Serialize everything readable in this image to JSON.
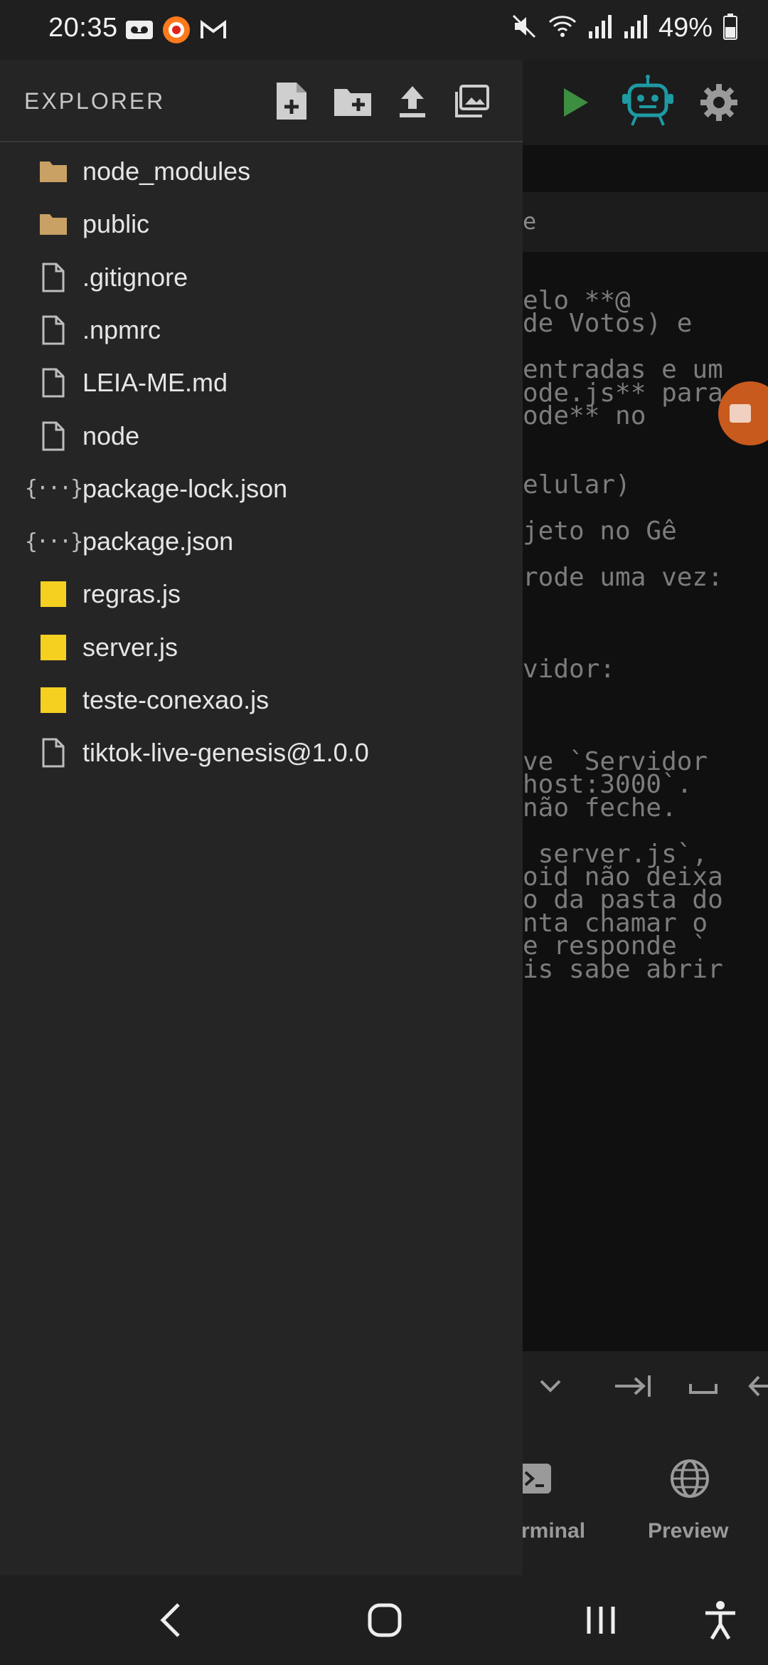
{
  "status_bar": {
    "time": "20:35",
    "battery_percent": "49%",
    "left_icons": [
      "voicemail-icon",
      "recorder-icon",
      "gmail-icon"
    ],
    "right_icons": [
      "mute-icon",
      "wifi-icon",
      "signal-icon",
      "signal-icon",
      "battery-icon"
    ]
  },
  "drawer": {
    "title": "EXPLORER",
    "header_actions": [
      "new-file-icon",
      "new-folder-icon",
      "upload-icon",
      "image-icon"
    ],
    "files": [
      {
        "name": "node_modules",
        "type": "folder"
      },
      {
        "name": "public",
        "type": "folder"
      },
      {
        "name": ".gitignore",
        "type": "file"
      },
      {
        "name": ".npmrc",
        "type": "file"
      },
      {
        "name": "LEIA-ME.md",
        "type": "file"
      },
      {
        "name": "node",
        "type": "file"
      },
      {
        "name": "package-lock.json",
        "type": "json"
      },
      {
        "name": "package.json",
        "type": "json"
      },
      {
        "name": "regras.js",
        "type": "js"
      },
      {
        "name": "server.js",
        "type": "js"
      },
      {
        "name": "teste-conexao.js",
        "type": "js"
      },
      {
        "name": "tiktok-live-genesis@1.0.0",
        "type": "file"
      }
    ],
    "json_glyph": "{···}"
  },
  "editor": {
    "toolbar_icons": [
      "play-icon",
      "robot-icon",
      "gear-icon"
    ],
    "tab_fragment": "e",
    "code_lines": [
      "elo **@",
      "de Votos) e",
      "",
      "entradas e um",
      "ode.js** para",
      "ode** no",
      "",
      "",
      "elular)",
      "",
      "jeto no Gê",
      "",
      "rode uma vez:",
      "",
      "",
      "",
      "vidor:",
      "",
      "",
      "",
      "ve `Servidor",
      "host:3000`.",
      "não feche.",
      "",
      " server.js`,",
      "oid não deixa",
      "o da pasta do",
      "nta chamar o",
      "e responde `",
      "is sabe abrir"
    ],
    "keybar_icons": [
      "chevron-down-icon",
      "tab-icon",
      "space-icon",
      "arrow-left-icon"
    ],
    "bottom_nav": [
      {
        "label": "rminal",
        "icon": "terminal-icon"
      },
      {
        "label": "Preview",
        "icon": "globe-icon"
      }
    ]
  },
  "system_nav": [
    "back-icon",
    "home-icon",
    "recents-icon",
    "accessibility-icon"
  ],
  "colors": {
    "drawer_bg": "#252526",
    "folder": "#c9a164",
    "js_badge": "#f5d020",
    "robot": "#1e9aa3",
    "play": "#3e8e41",
    "float_button": "#c85a1e"
  }
}
